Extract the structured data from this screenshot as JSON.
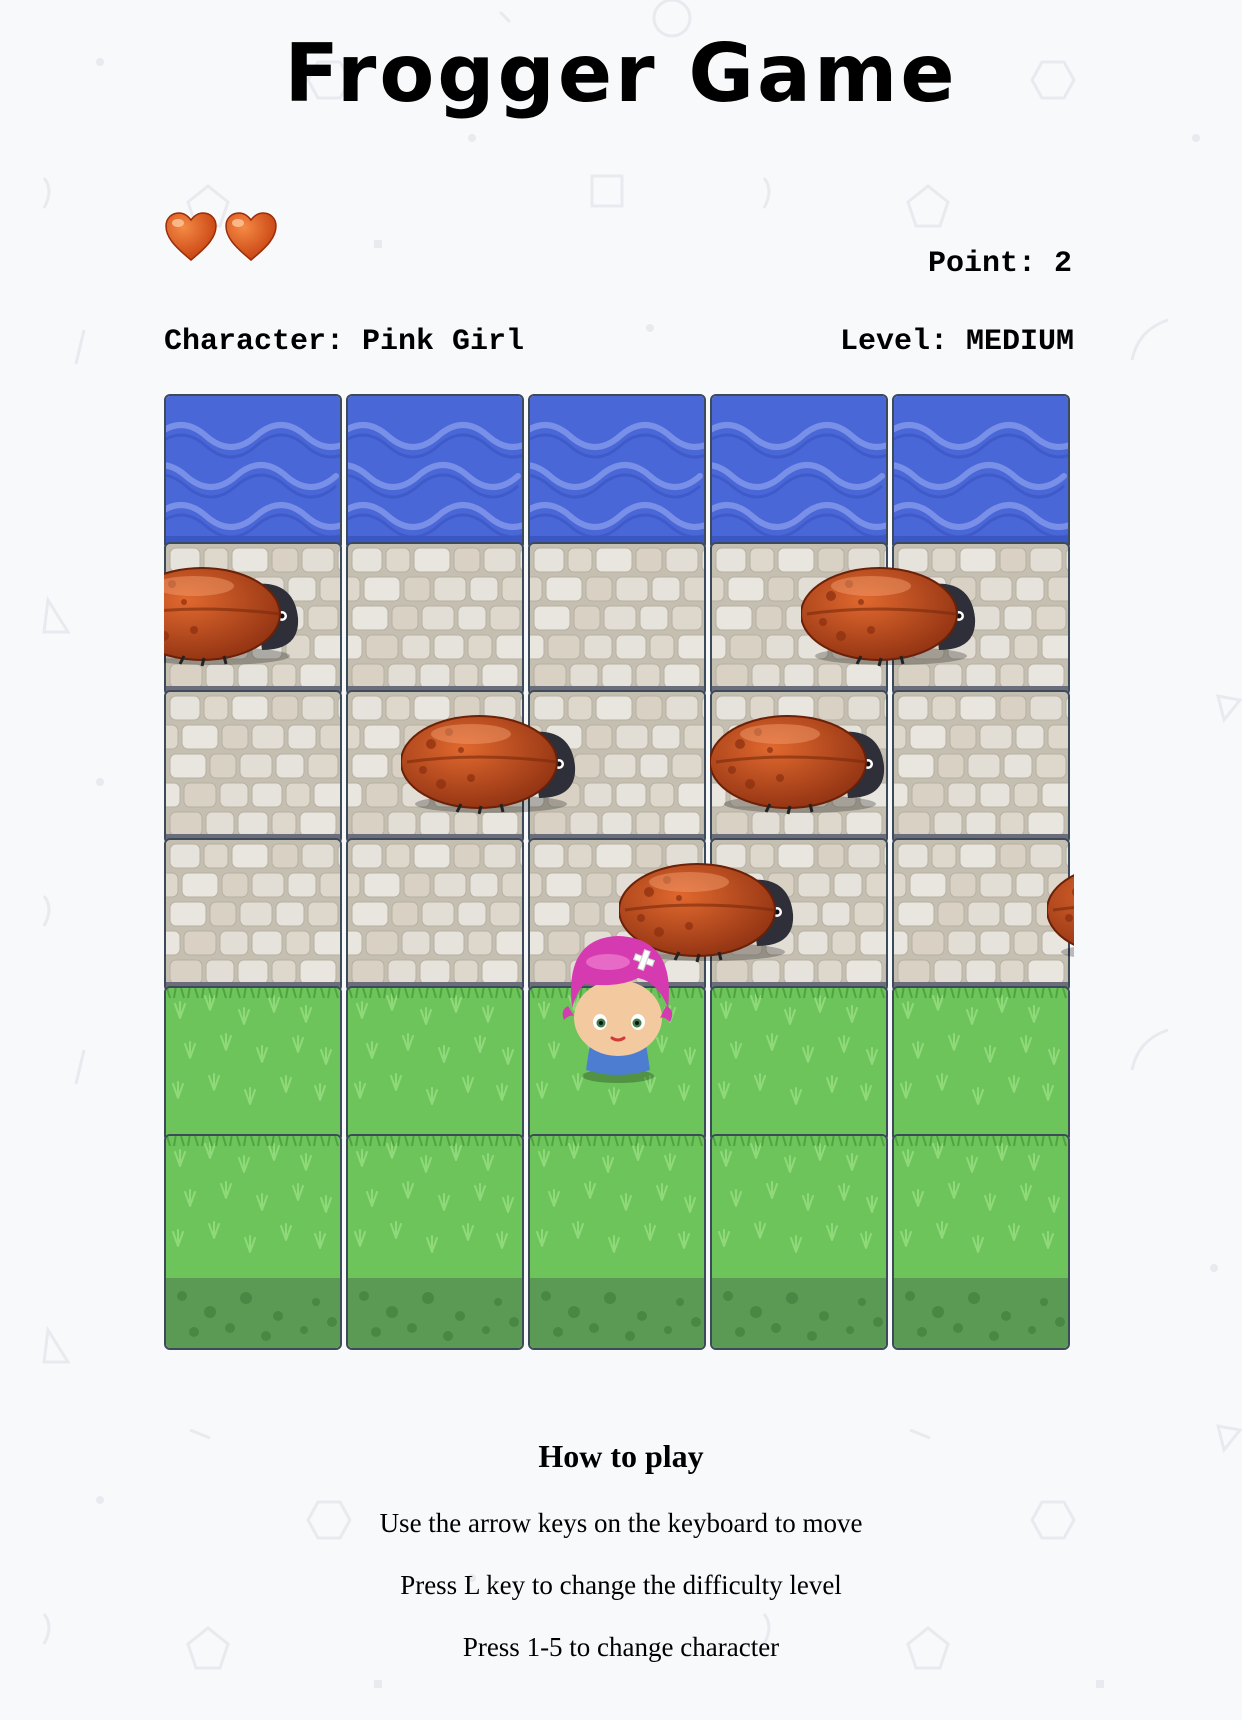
{
  "game": {
    "title": "Frogger Game",
    "lives": 2,
    "point_label": "Point: 2",
    "character_label": "Character: Pink Girl",
    "level_label": "Level: MEDIUM"
  },
  "board": {
    "columns": 5,
    "rows": [
      "water",
      "stone",
      "stone",
      "stone",
      "grass",
      "grass"
    ],
    "player": {
      "character": "Pink Girl",
      "row": 4,
      "col": 2
    },
    "enemies": [
      {
        "type": "bug",
        "row": 1,
        "col": 0
      },
      {
        "type": "bug",
        "row": 1,
        "col": 3.5
      },
      {
        "type": "bug",
        "row": 2,
        "col": 1.3
      },
      {
        "type": "bug",
        "row": 2,
        "col": 3.0
      },
      {
        "type": "bug",
        "row": 3,
        "col": 2.5
      },
      {
        "type": "bug",
        "row": 3,
        "col": 4.85
      }
    ]
  },
  "help": {
    "heading": "How to play",
    "lines": [
      "Use the arrow keys on the keyboard to move",
      "Press L key to change the difficulty level",
      "Press 1-5 to change character"
    ]
  },
  "colors": {
    "water": "#4a67d8",
    "stone": "#d6d1c6",
    "grass": "#6cc45a",
    "dirt": "#5a9a55",
    "bug": "#b84a1f",
    "hair": "#d63ab0"
  },
  "icons": [
    "heart-icon",
    "bug-enemy-icon",
    "pink-girl-icon"
  ]
}
